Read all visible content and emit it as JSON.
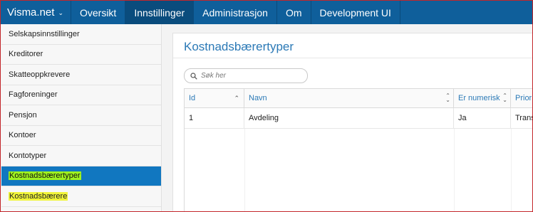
{
  "topnav": {
    "brand": "Visma.net",
    "items": [
      "Oversikt",
      "Innstillinger",
      "Administrasjon",
      "Om",
      "Development UI"
    ],
    "active_index": 1
  },
  "sidebar": {
    "items": [
      {
        "label": "Selskapsinnstillinger"
      },
      {
        "label": "Kreditorer"
      },
      {
        "label": "Skatteoppkrevere"
      },
      {
        "label": "Fagforeninger"
      },
      {
        "label": "Pensjon"
      },
      {
        "label": "Kontoer"
      },
      {
        "label": "Kontotyper"
      },
      {
        "label": "Kostnadsbærertyper"
      },
      {
        "label": "Kostnadsbærere"
      }
    ],
    "active_index": 7
  },
  "main": {
    "title": "Kostnadsbærertyper",
    "search": {
      "placeholder": "Søk her",
      "value": ""
    },
    "table": {
      "columns": [
        "Id",
        "Navn",
        "Er numerisk",
        "Prior"
      ],
      "rows": [
        [
          "1",
          "Avdeling",
          "Ja",
          "Trans"
        ]
      ]
    }
  },
  "colors": {
    "nav_bg": "#0f5f9b",
    "nav_active": "#0a4c7d",
    "sidebar_active": "#1177c0",
    "accent_text": "#2b79b6",
    "highlight_yellow": "#f1f53a",
    "highlight_green": "#9ff21f",
    "frame_border": "#c3262b"
  }
}
